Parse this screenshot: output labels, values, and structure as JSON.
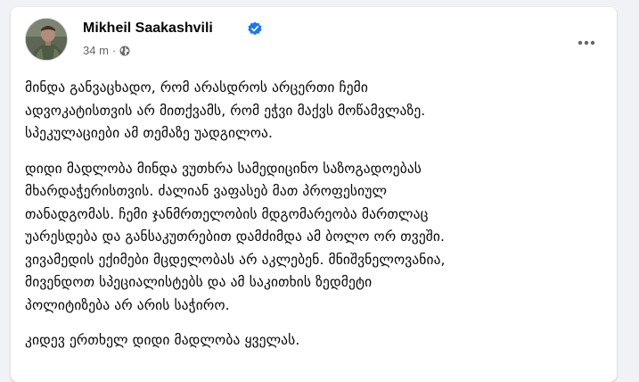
{
  "post": {
    "author": "Mikheil Saakashvili",
    "time": "34 m",
    "separator": "·",
    "privacy_icon": "globe-icon",
    "verified_icon": "verified-badge-icon",
    "more_icon": "more-options-icon",
    "colors": {
      "verified": "#1877f2",
      "meta": "#65676b",
      "text": "#050505",
      "background": "#f0f2f5"
    },
    "paragraphs": [
      {
        "lines": [
          "მინდა განვაცხადო, რომ არასდროს არცერთი ჩემი",
          "ადვოკატისთვის არ მითქვამს, რომ ეჭვი მაქვს მოწამვლაზე.",
          "სპეკულაციები ამ თემაზე უადგილოა."
        ]
      },
      {
        "lines": [
          "დიდი მადლობა მინდა ვუთხრა სამედიცინო საზოგადოებას",
          "მხარდაჭერისთვის. ძალიან ვაფასებ მათ პროფესიულ",
          "თანადგომას. ჩემი ჯანმრთელობის მდგომარეობა მართლაც",
          "უარესდება და განსაკუთრებით დამძიმდა ამ ბოლო ორ თვეში.",
          "ვივამედის ექიმები მცდელობას არ აკლებენ. მნიშვნელოვანია,",
          "მივენდოთ სპეციალისტებს და ამ საკითხის ზედმეტი",
          "პოლიტიზება არ არის საჭირო."
        ]
      },
      {
        "lines": [
          "კიდევ ერთხელ დიდი მადლობა ყველას."
        ]
      }
    ]
  }
}
